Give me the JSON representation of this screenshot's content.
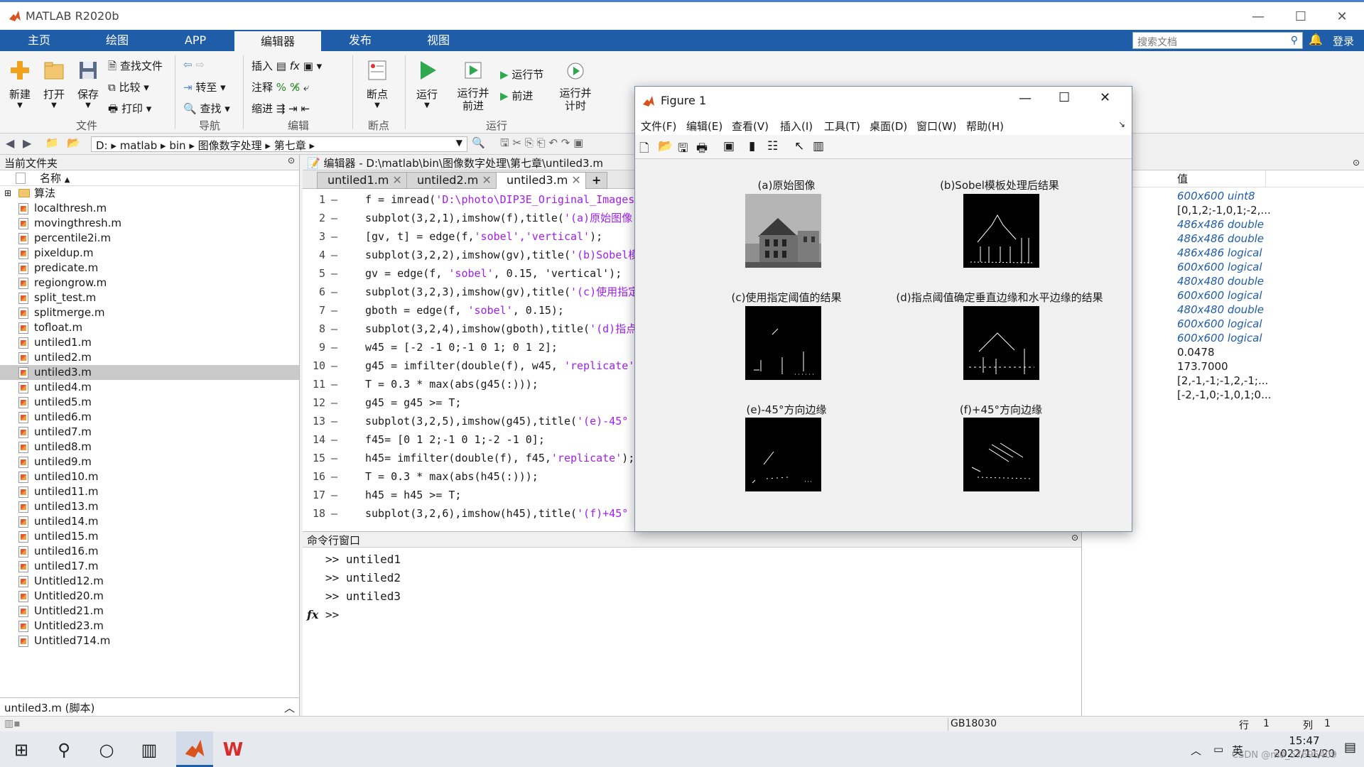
{
  "app": {
    "title": "MATLAB R2020b"
  },
  "ribbon_tabs": [
    "主页",
    "绘图",
    "APP",
    "编辑器",
    "发布",
    "视图"
  ],
  "search": {
    "placeholder": "搜索文档"
  },
  "login": "登录",
  "ribbon": {
    "new": "新建",
    "open": "打开",
    "save": "保存",
    "find_files": "查找文件",
    "compare": "比较",
    "print": "打印",
    "goto": "转至",
    "find": "查找",
    "insert": "插入",
    "comment": "注释",
    "indent": "缩进",
    "breakpoints": "断点",
    "run": "运行",
    "run_advance": "运行并\n前进",
    "run_section": "运行节",
    "advance": "前进",
    "run_time": "运行并\n计时",
    "groups": {
      "file": "文件",
      "nav": "导航",
      "edit": "编辑",
      "bp": "断点",
      "run": "运行"
    }
  },
  "address": {
    "path": [
      "D:",
      "matlab",
      "bin",
      "图像数字处理",
      "第七章"
    ]
  },
  "current_folder": {
    "header": "当前文件夹",
    "col_name": "名称",
    "folder": "算法",
    "files": [
      "localthresh.m",
      "movingthresh.m",
      "percentile2i.m",
      "pixeldup.m",
      "predicate.m",
      "regiongrow.m",
      "split_test.m",
      "splitmerge.m",
      "tofloat.m",
      "untiled1.m",
      "untiled2.m",
      "untiled3.m",
      "untiled4.m",
      "untiled5.m",
      "untiled6.m",
      "untiled7.m",
      "untiled8.m",
      "untiled9.m",
      "untiled10.m",
      "untiled11.m",
      "untiled13.m",
      "untiled14.m",
      "untiled15.m",
      "untiled16.m",
      "untiled17.m",
      "Untitled12.m",
      "Untitled20.m",
      "Untitled21.m",
      "Untitled23.m",
      "Untitled714.m"
    ],
    "selected": "untiled3.m",
    "details": "untiled3.m  (脚本)"
  },
  "editor": {
    "header": "编辑器 - D:\\matlab\\bin\\图像数字处理\\第七章\\untiled3.m",
    "tabs": [
      "untiled1.m",
      "untiled2.m",
      "untiled3.m"
    ],
    "lines": [
      {
        "n": "1",
        "code": "f = imread(",
        "str": "'D:\\photo\\DIP3E_Original_Images_",
        "rest": ""
      },
      {
        "n": "2",
        "code": "subplot(3,2,1),imshow(f),title(",
        "str": "'(a)原始图像'",
        "rest": ""
      },
      {
        "n": "3",
        "code": "[gv, t] = edge(f,",
        "str": "'sobel','vertical'",
        "rest": ");"
      },
      {
        "n": "4",
        "code": "subplot(3,2,2),imshow(gv),title(",
        "str": "'(b)Sobel模",
        "rest": ""
      },
      {
        "n": "5",
        "code": "gv = edge(f, ",
        "str": "'sobel'",
        "rest": ", 0.15, 'vertical');"
      },
      {
        "n": "6",
        "code": "subplot(3,2,3),imshow(gv),title(",
        "str": "'(c)使用指定",
        "rest": ""
      },
      {
        "n": "7",
        "code": "gboth = edge(f, ",
        "str": "'sobel'",
        "rest": ", 0.15);"
      },
      {
        "n": "8",
        "code": "subplot(3,2,4),imshow(gboth),title(",
        "str": "'(d)指点",
        "rest": ""
      },
      {
        "n": "9",
        "code": "w45 = [-2 -1 0;-1 0 1; 0 1 2];",
        "str": "",
        "rest": ""
      },
      {
        "n": "10",
        "code": "g45 = imfilter(double(f), w45, ",
        "str": "'replicate'",
        "rest": ")"
      },
      {
        "n": "11",
        "code": "T = 0.3 * max(abs(g45(:)));",
        "str": "",
        "rest": ""
      },
      {
        "n": "12",
        "code": "g45 = g45 >= T;",
        "str": "",
        "rest": ""
      },
      {
        "n": "13",
        "code": "subplot(3,2,5),imshow(g45),title(",
        "str": "'(e)-45° 方",
        "rest": ""
      },
      {
        "n": "14",
        "code": "f45= [0 1 2;-1 0 1;-2 -1 0];",
        "str": "",
        "rest": ""
      },
      {
        "n": "15",
        "code": "h45= imfilter(double(f), f45,",
        "str": "'replicate'",
        "rest": ");"
      },
      {
        "n": "16",
        "code": "T = 0.3 * max(abs(h45(:)));",
        "str": "",
        "rest": ""
      },
      {
        "n": "17",
        "code": "h45 = h45 >= T;",
        "str": "",
        "rest": ""
      },
      {
        "n": "18",
        "code": "subplot(3,2,6),imshow(h45),title(",
        "str": "'(f)+45° 方",
        "rest": ""
      }
    ]
  },
  "command_window": {
    "header": "命令行窗口",
    "lines": [
      ">> untiled1",
      ">> untiled2",
      ">> untiled3"
    ],
    "prompt": ">>",
    "fx": "fx"
  },
  "workspace": {
    "col_value": "值",
    "values": [
      {
        "v": "600x600 uint8",
        "italic": true
      },
      {
        "v": "[0,1,2;-1,0,1;-2,...",
        "italic": false
      },
      {
        "v": "486x486 double",
        "italic": true
      },
      {
        "v": "486x486 double",
        "italic": true
      },
      {
        "v": "486x486 logical",
        "italic": true
      },
      {
        "v": "600x600 logical",
        "italic": true
      },
      {
        "v": "480x480 double",
        "italic": true
      },
      {
        "v": "600x600 logical",
        "italic": true
      },
      {
        "v": "480x480 double",
        "italic": true
      },
      {
        "v": "600x600 logical",
        "italic": true
      },
      {
        "v": "600x600 logical",
        "italic": true
      },
      {
        "v": "0.0478",
        "italic": false
      },
      {
        "v": "173.7000",
        "italic": false
      },
      {
        "v": "[2,-1,-1;-1,2,-1;...",
        "italic": false
      },
      {
        "v": "[-2,-1,0;-1,0,1;0...",
        "italic": false
      }
    ]
  },
  "status": {
    "encoding": "GB18030",
    "row_label": "行",
    "row": "1",
    "col_label": "列",
    "col": "1"
  },
  "figure": {
    "title": "Figure 1",
    "menu": [
      "文件(F)",
      "编辑(E)",
      "查看(V)",
      "插入(I)",
      "工具(T)",
      "桌面(D)",
      "窗口(W)",
      "帮助(H)"
    ],
    "subplots": [
      "(a)原始图像",
      "(b)Sobel模板处理后结果",
      "(c)使用指定阈值的结果",
      "(d)指点阈值确定垂直边缘和水平边缘的结果",
      "(e)-45°方向边缘",
      "(f)+45°方向边缘"
    ]
  },
  "taskbar": {
    "time": "15:47",
    "date": "2022/11/20",
    "lang": "英",
    "watermark": "CSDN @m0_57695409"
  },
  "colors": {
    "ribbon_blue": "#1f5da8",
    "string": "#a020f0",
    "ws_italic": "#1f5da8",
    "selection": "#c9c9c9"
  }
}
